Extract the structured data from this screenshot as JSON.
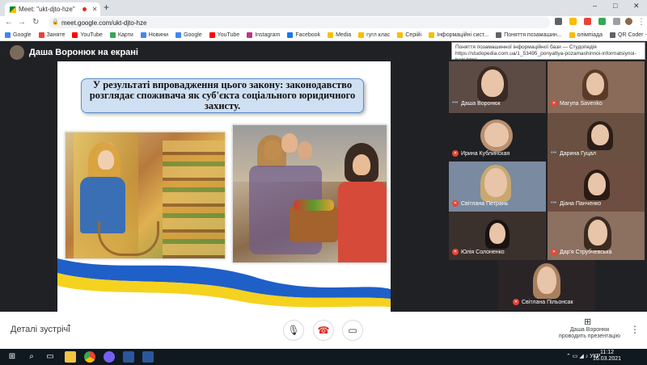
{
  "browser": {
    "tab_title": "Meet: \"ukt-djto-hze\"",
    "new_tab_label": "+",
    "url": "meet.google.com/ukt-djto-hze",
    "window_controls": {
      "minimize": "–",
      "maximize": "□",
      "close": "✕"
    }
  },
  "bookmarks": [
    {
      "label": "Google",
      "color": "#4285f4"
    },
    {
      "label": "Заняте",
      "color": "#ea4335"
    },
    {
      "label": "YouTube",
      "color": "#ff0000"
    },
    {
      "label": "Карти",
      "color": "#34a853"
    },
    {
      "label": "Новини",
      "color": "#4285f4"
    },
    {
      "label": "Google",
      "color": "#4285f4"
    },
    {
      "label": "YouTube",
      "color": "#ff0000"
    },
    {
      "label": "Instagram",
      "color": "#c13584"
    },
    {
      "label": "Facebook",
      "color": "#1877f2"
    },
    {
      "label": "Media",
      "color": "#fbbc04"
    },
    {
      "label": "гугл клас",
      "color": "#fbbc04"
    },
    {
      "label": "Серійі",
      "color": "#fbbc04"
    },
    {
      "label": "Інформаційні сист...",
      "color": "#fbbc04"
    },
    {
      "label": "Поняття позамашин...",
      "color": "#5f6368"
    },
    {
      "label": "олімпіада",
      "color": "#fbbc04"
    },
    {
      "label": "QR Coder - Генера...",
      "color": "#5f6368"
    }
  ],
  "meet": {
    "presenter_title": "Даша Воронюк на екрані",
    "tooltip": {
      "line1": "Поняття позамашинної інформаційної бази — Студопедія",
      "line2": "https://studopedia.com.ua/1_53495_ponyattya-pozamashinnoi-informatsiynoi-bazi.html"
    },
    "slide": {
      "title": "У результаті впровадження цього закону: законодавство розглядає споживача як суб'єкта соціального юридичного захисту."
    },
    "participants": [
      {
        "name": "Даша Воронюк",
        "mic": "on"
      },
      {
        "name": "Магупа Savenko",
        "mic": "off"
      },
      {
        "name": "Ирина Кублинская",
        "mic": "off"
      },
      {
        "name": "Дарина Гуцал",
        "mic": "on"
      },
      {
        "name": "Світлана Петрань",
        "mic": "off"
      },
      {
        "name": "Діана Панченко",
        "mic": "on"
      },
      {
        "name": "Юлія Солоненко",
        "mic": "off"
      },
      {
        "name": "Дар'я Струбчевська",
        "mic": "off"
      },
      {
        "name": "Світлана Пільонсак",
        "mic": "off"
      }
    ],
    "bottom": {
      "details_label": "Деталі зустрічі",
      "present_label_1": "Даша Воронюк",
      "present_label_2": "проводить презентацію"
    }
  },
  "taskbar": {
    "language": "УКР",
    "time": "11:12",
    "date": "16.03.2021"
  }
}
